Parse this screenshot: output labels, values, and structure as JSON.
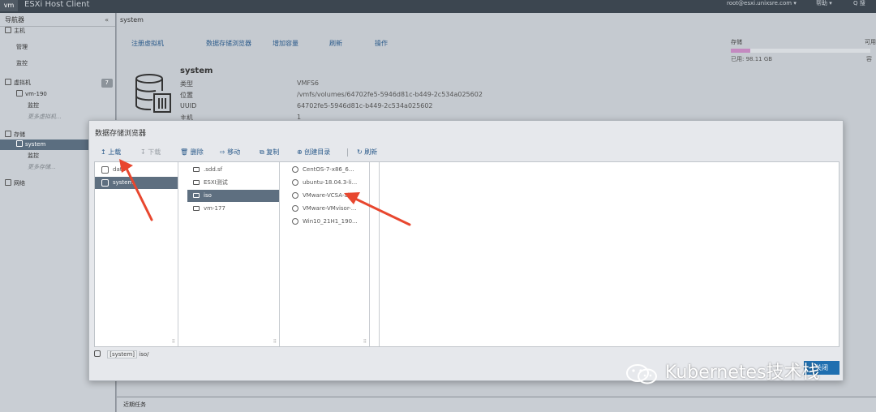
{
  "topbar": {
    "logo": "vm",
    "title": "ESXi Host Client",
    "user": "root@esxi.unixsre.com ▾",
    "help": "帮助 ▾",
    "search": "Q 搜"
  },
  "navigator": {
    "title": "导航器",
    "collapse": "«",
    "items": [
      {
        "label": "主机",
        "indent": 0
      },
      {
        "label": "管理",
        "indent": 1
      },
      {
        "label": "监控",
        "indent": 1
      },
      {
        "label": "虚拟机",
        "indent": 0,
        "badge": "7"
      },
      {
        "label": "vm-190",
        "indent": 1
      },
      {
        "label": "监控",
        "indent": 2
      },
      {
        "label": "更多虚拟机...",
        "indent": 2,
        "muted": true
      },
      {
        "label": "存储",
        "indent": 0
      },
      {
        "label": "system",
        "indent": 1,
        "selected": true
      },
      {
        "label": "监控",
        "indent": 2
      },
      {
        "label": "更多存储...",
        "indent": 2,
        "muted": true
      },
      {
        "label": "网络",
        "indent": 0
      }
    ]
  },
  "main": {
    "tab": "system",
    "toolbar": [
      "注册虚拟机",
      "数据存储浏览器",
      "增加容量",
      "刷新",
      "操作"
    ],
    "datastore_name": "system",
    "properties": [
      {
        "key": "类型",
        "value": "VMFS6"
      },
      {
        "key": "位置",
        "value": "/vmfs/volumes/64702fe5-5946d81c-b449-2c534a025602"
      },
      {
        "key": "UUID",
        "value": "64702fe5-5946d81c-b449-2c534a025602"
      },
      {
        "key": "主机",
        "value": "1"
      }
    ],
    "storage_label": "存储",
    "available_label": "可用",
    "used_label": "已用: 98.11 GB",
    "used_fraction": 0.14,
    "used_right": "容"
  },
  "recent_tasks": "近期任务",
  "browser": {
    "title": "数据存储浏览器",
    "toolbar": [
      {
        "label": "上载",
        "disabled": false
      },
      {
        "label": "下载",
        "disabled": true
      },
      {
        "label": "删除",
        "disabled": false
      },
      {
        "label": "移动",
        "disabled": false
      },
      {
        "label": "复制",
        "disabled": false
      },
      {
        "label": "创建目录",
        "disabled": false
      },
      {
        "label": "刷新",
        "disabled": false
      }
    ],
    "datastores": [
      {
        "name": "data",
        "selected": false
      },
      {
        "name": "system",
        "selected": true
      }
    ],
    "folders": [
      {
        "name": ".sdd.sf",
        "selected": false
      },
      {
        "name": "ESXI测试",
        "selected": false
      },
      {
        "name": "iso",
        "selected": true
      },
      {
        "name": "vm-177",
        "selected": false
      }
    ],
    "files": [
      {
        "name": "CentOS-7-x86_6..."
      },
      {
        "name": "ubuntu-18.04.3-li..."
      },
      {
        "name": "VMware-VCSA-all-..."
      },
      {
        "name": "VMware-VMvisor-..."
      },
      {
        "name": "Win10_21H1_190..."
      }
    ],
    "path_ds": "[system]",
    "path": "iso/",
    "close_label": "关闭"
  },
  "watermark": "Kubernetes技术栈",
  "colors": {
    "topbar": "#3c4650",
    "selected_row": "#5e6f80",
    "link": "#2a5a8a",
    "primary_button": "#1f6fb0",
    "arrow": "#e8472f"
  }
}
